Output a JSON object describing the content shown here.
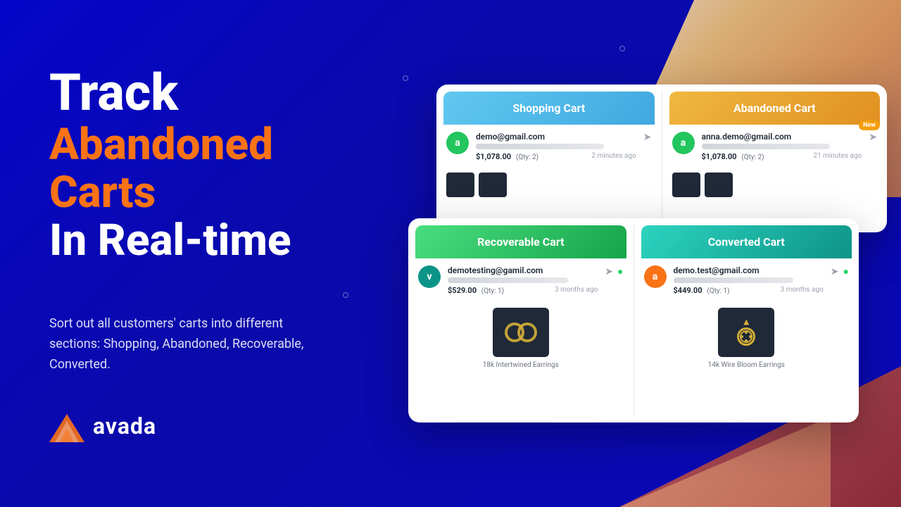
{
  "background": {
    "mainColor": "#0a0aaa"
  },
  "headline": {
    "line1": "Track",
    "line2": "Abandoned Carts",
    "line3": "In Real-time"
  },
  "description": "Sort out all customers' carts into different sections: Shopping, Abandoned, Recoverable, Converted.",
  "logo": {
    "text": "avada"
  },
  "shoppingCartPanel": {
    "title": "Shopping Cart",
    "email": "demo@gmail.com",
    "price": "$1,078.00",
    "qty": "(Qty: 2)",
    "time": "2 minutes ago",
    "avatarLetter": "a"
  },
  "abandonedCartPanel": {
    "title": "Abandoned Cart",
    "email": "anna.demo@gmail.com",
    "price": "$1,078.00",
    "qty": "(Qty: 2)",
    "time": "21 minutes ago",
    "avatarLetter": "a",
    "badge": "New"
  },
  "recoverableCartPanel": {
    "title": "Recoverable Cart",
    "email": "demotesting@gamil.com",
    "price": "$529.00",
    "qty": "(Qty: 1)",
    "time": "3 months ago",
    "avatarLetter": "v",
    "productLabel": "18k Intertwined Earrings"
  },
  "convertedCartPanel": {
    "title": "Converted Cart",
    "email": "demo.test@gmail.com",
    "price": "$449.00",
    "qty": "(Qty: 1)",
    "time": "3 months ago",
    "avatarLetter": "a",
    "productLabel": "14k Wire Bloom Earrings"
  }
}
